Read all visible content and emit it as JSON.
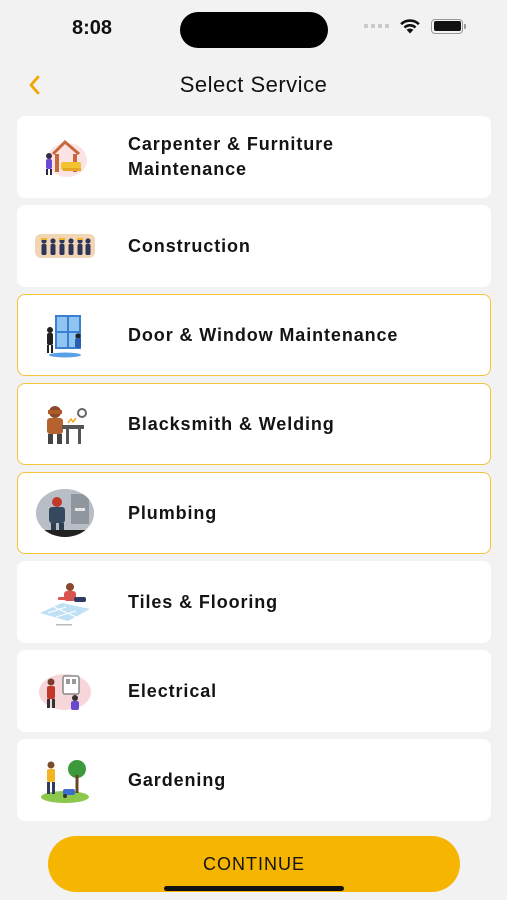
{
  "status_bar": {
    "time": "8:08"
  },
  "header": {
    "title": "Select Service",
    "back_icon": "chevron-left-icon",
    "accent": "#f5a300"
  },
  "services": [
    {
      "label": "Carpenter & Furniture Maintenance",
      "icon": "carpenter-icon",
      "selected": false
    },
    {
      "label": "Construction",
      "icon": "construction-workers-icon",
      "selected": false
    },
    {
      "label": "Door & Window Maintenance",
      "icon": "door-window-icon",
      "selected": true
    },
    {
      "label": "Blacksmith & Welding",
      "icon": "welding-icon",
      "selected": true
    },
    {
      "label": "Plumbing",
      "icon": "plumbing-icon",
      "selected": true
    },
    {
      "label": "Tiles & Flooring",
      "icon": "tiles-flooring-icon",
      "selected": false
    },
    {
      "label": "Electrical",
      "icon": "electrical-icon",
      "selected": false
    },
    {
      "label": "Gardening",
      "icon": "gardening-icon",
      "selected": false
    }
  ],
  "continue_label": "CONTINUE",
  "colors": {
    "selected_border": "#f5c438",
    "button": "#f6b500",
    "background": "#f2f2f2"
  }
}
